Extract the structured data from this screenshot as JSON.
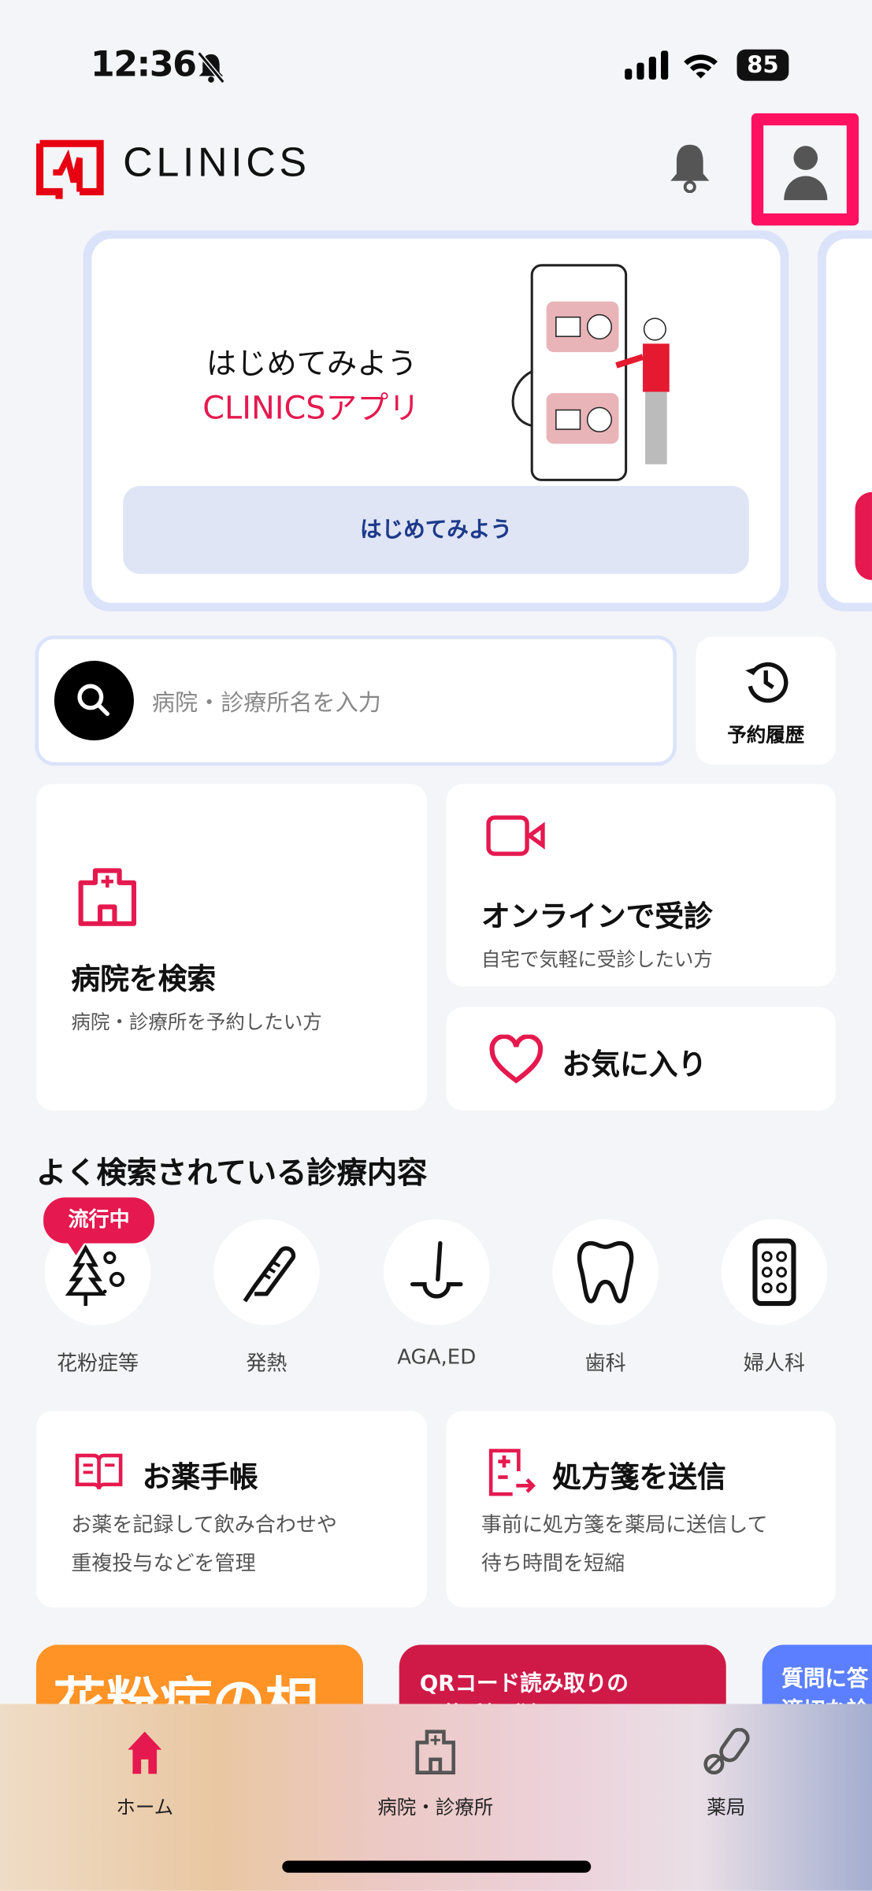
{
  "status_bar": {
    "time": "12:36",
    "battery": "85",
    "silent": true
  },
  "header": {
    "logo": "CLINICS",
    "notification_icon": "bell-icon",
    "profile_icon": "person-icon",
    "highlight_color": "#ff1060"
  },
  "banner": {
    "title_line1": "はじめてみよう",
    "title_line2": "CLINICSアプリ",
    "button": "はじめてみよう"
  },
  "search": {
    "placeholder": "病院・診療所名を入力",
    "history_label": "予約履歴"
  },
  "actions": {
    "hospital": {
      "title": "病院を検索",
      "subtitle": "病院・診療所を予約したい方"
    },
    "online": {
      "title": "オンラインで受診",
      "subtitle": "自宅で気軽に受診したい方"
    },
    "favorites": {
      "title": "お気に入り"
    }
  },
  "popular": {
    "title": "よく検索されている診療内容",
    "badge": "流行中",
    "items": [
      {
        "label": "花粉症等",
        "icon": "pollen-tree-icon"
      },
      {
        "label": "発熱",
        "icon": "thermometer-icon"
      },
      {
        "label": "AGA,ED",
        "icon": "hair-follicle-icon"
      },
      {
        "label": "歯科",
        "icon": "tooth-icon"
      },
      {
        "label": "婦人科",
        "icon": "pill-pack-icon"
      }
    ]
  },
  "services": {
    "notebook": {
      "title": "お薬手帳",
      "desc1": "お薬を記録して飲み合わせや",
      "desc2": "重複投与などを管理"
    },
    "prescription": {
      "title": "処方箋を送信",
      "desc1": "事前に処方箋を薬局に送信して",
      "desc2": "待ち時間を短縮"
    }
  },
  "promos": [
    {
      "text": "花粉症の相談",
      "color": "#ff9326"
    },
    {
      "text1": "QRコード読み取りの",
      "text2": "お薬手帳登録で",
      "color": "#cf1a48"
    },
    {
      "text1": "質問に答",
      "text2": "適切な診",
      "color": "#5b7fff"
    }
  ],
  "bottom_nav": [
    {
      "label": "ホーム",
      "active": true
    },
    {
      "label": "病院・診療所"
    },
    {
      "label": "薬局"
    }
  ],
  "colors": {
    "accent": "#e5194f",
    "banner_button": "#dfe5f5"
  }
}
